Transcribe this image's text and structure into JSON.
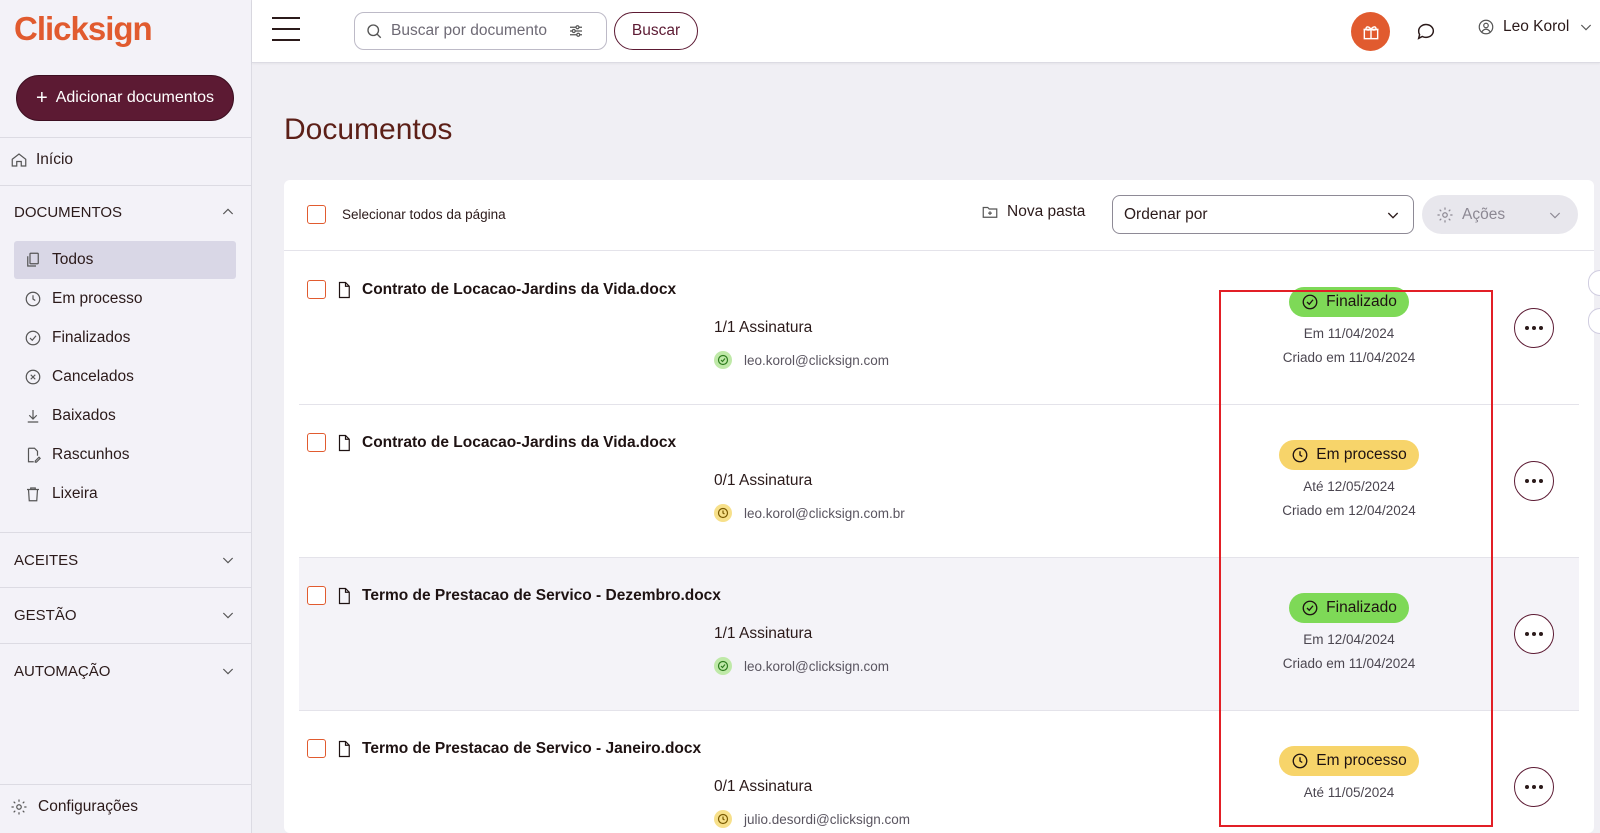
{
  "brand": {
    "name": "Clicksign",
    "accent": "#e15b2f",
    "primary": "#5c1a33"
  },
  "sidebar": {
    "add_button": "Adicionar documentos",
    "home": "Início",
    "documents_section": "DOCUMENTOS",
    "document_items": [
      {
        "label": "Todos",
        "icon": "documents-icon",
        "active": true
      },
      {
        "label": "Em processo",
        "icon": "clock-icon"
      },
      {
        "label": "Finalizados",
        "icon": "check-circle-icon"
      },
      {
        "label": "Cancelados",
        "icon": "x-circle-icon"
      },
      {
        "label": "Baixados",
        "icon": "download-icon"
      },
      {
        "label": "Rascunhos",
        "icon": "draft-icon"
      },
      {
        "label": "Lixeira",
        "icon": "trash-icon"
      }
    ],
    "sections": [
      "ACEITES",
      "GESTÃO",
      "AUTOMAÇÃO"
    ],
    "settings": "Configurações"
  },
  "topbar": {
    "search_placeholder": "Buscar por documento",
    "search_button": "Buscar",
    "user_name": "Leo Korol"
  },
  "main": {
    "title": "Documentos",
    "select_all": "Selecionar todos da página",
    "new_folder": "Nova pasta",
    "sort_label": "Ordenar por",
    "actions_label": "Ações",
    "documents": [
      {
        "name": "Contrato de Locacao-Jardins da Vida.docx",
        "signatures": "1/1 Assinatura",
        "signer": "leo.korol@clicksign.com",
        "signer_state": "signed",
        "status": "Finalizado",
        "status_kind": "done",
        "date": "Em 11/04/2024",
        "created": "Criado em 11/04/2024"
      },
      {
        "name": "Contrato de Locacao-Jardins da Vida.docx",
        "signatures": "0/1 Assinatura",
        "signer": "leo.korol@clicksign.com.br",
        "signer_state": "pending",
        "status": "Em processo",
        "status_kind": "processing",
        "date": "Até 12/05/2024",
        "created": "Criado em 12/04/2024"
      },
      {
        "name": "Termo de Prestacao de Servico - Dezembro.docx",
        "signatures": "1/1 Assinatura",
        "signer": "leo.korol@clicksign.com",
        "signer_state": "signed",
        "status": "Finalizado",
        "status_kind": "done",
        "date": "Em 12/04/2024",
        "created": "Criado em 11/04/2024"
      },
      {
        "name": "Termo de Prestacao de Servico - Janeiro.docx",
        "signatures": "0/1 Assinatura",
        "signer": "julio.desordi@clicksign.com",
        "signer_state": "pending",
        "status": "Em processo",
        "status_kind": "processing",
        "date": "Até 11/05/2024",
        "created": ""
      }
    ]
  },
  "colors": {
    "finalized_badge": "#7ed957",
    "processing_badge": "#f7d46a",
    "highlight_box": "#e21f26"
  }
}
